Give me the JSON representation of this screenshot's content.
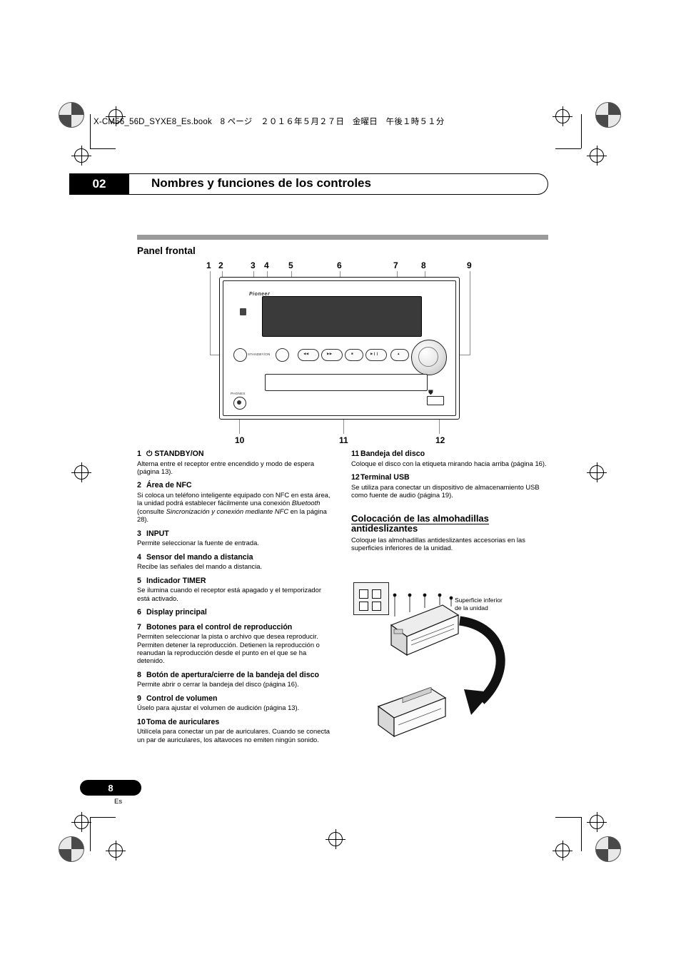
{
  "header": {
    "book_line": "X-CM56_56D_SYXE8_Es.book　8 ページ　２０１６年５月２７日　金曜日　午後１時５１分"
  },
  "chapter": {
    "number": "02",
    "title": "Nombres y funciones de los controles"
  },
  "section": {
    "title": "Panel frontal"
  },
  "diagram": {
    "top_callouts": [
      "1",
      "2",
      "3",
      "4",
      "5",
      "6",
      "7",
      "8",
      "9"
    ],
    "bottom_callouts": [
      "10",
      "11",
      "12"
    ],
    "brand": "Pioneer",
    "labels": {
      "standby": "STANDBY/ON",
      "input": "INPUT",
      "phones": "PHONES",
      "usb": "USB"
    }
  },
  "items_left": [
    {
      "num": "1",
      "title": "⏻ STANDBY/ON",
      "body": "Alterna entre el receptor entre encendido y modo de espera (página 13)."
    },
    {
      "num": "2",
      "title": "Área de NFC",
      "body": "Si coloca un teléfono inteligente equipado con NFC en esta área, la unidad podrá establecer fácilmente una conexión <i>Bluetooth</i> (consulte <i>Sincronización y conexión mediante NFC</i> en la página 28)."
    },
    {
      "num": "3",
      "title": "INPUT",
      "body": "Permite seleccionar la fuente de entrada."
    },
    {
      "num": "4",
      "title": "Sensor del mando a distancia",
      "body": "Recibe las señales del mando a distancia."
    },
    {
      "num": "5",
      "title": "Indicador TIMER",
      "body": "Se ilumina cuando el receptor está apagado y el temporizador está activado."
    },
    {
      "num": "6",
      "title": "Display principal",
      "body": ""
    },
    {
      "num": "7",
      "title": "Botones para el control de reproducción",
      "body": "Permiten seleccionar la pista o archivo que desea reproducir. Permiten detener la reproducción. Detienen la reproducción o reanudan la reproducción desde el punto en el que se ha detenido."
    },
    {
      "num": "8",
      "title": "Botón de apertura/cierre de la bandeja del disco",
      "body": "Permite abrir o cerrar la bandeja del disco (página 16)."
    },
    {
      "num": "9",
      "title": "Control de volumen",
      "body": "Úselo para ajustar el volumen de audición (página 13)."
    },
    {
      "num": "10",
      "title": "Toma de auriculares",
      "body": "Utilícela para conectar un par de auriculares. Cuando se conecta un par de auriculares, los altavoces no emiten ningún sonido."
    }
  ],
  "items_right": [
    {
      "num": "11",
      "title": "Bandeja del disco",
      "body": "Coloque el disco con la etiqueta mirando hacia arriba (página 16)."
    },
    {
      "num": "12",
      "title": "Terminal USB",
      "body": "Se utiliza para conectar un dispositivo de almacenamiento USB como fuente de audio (página 19)."
    }
  ],
  "pads_section": {
    "title_line1": "Colocación de las almohadillas",
    "title_line2": "antideslizantes",
    "body": "Coloque las almohadillas antideslizantes accesorias en las superficies inferiores de la unidad.",
    "figure_label_line1": "Superficie inferior",
    "figure_label_line2": "de la unidad"
  },
  "footer": {
    "page_number": "8",
    "language": "Es"
  }
}
